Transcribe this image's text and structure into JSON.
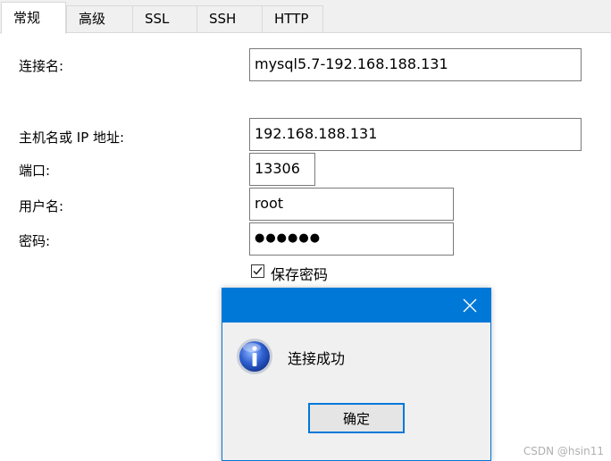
{
  "tabs": [
    {
      "label": "常规",
      "active": true
    },
    {
      "label": "高级",
      "active": false
    },
    {
      "label": "SSL",
      "active": false
    },
    {
      "label": "SSH",
      "active": false
    },
    {
      "label": "HTTP",
      "active": false
    }
  ],
  "form": {
    "connection_name_label": "连接名:",
    "connection_name_value": "mysql5.7-192.168.188.131",
    "host_label": "主机名或 IP 地址:",
    "host_value": "192.168.188.131",
    "port_label": "端口:",
    "port_value": "13306",
    "user_label": "用户名:",
    "user_value": "root",
    "password_label": "密码:",
    "password_value": "●●●●●●",
    "save_password_label": "保存密码",
    "save_password_checked": true
  },
  "dialog": {
    "message": "连接成功",
    "ok_label": "确定",
    "icon": "info-icon",
    "accent": "#0078d7"
  },
  "watermark": "CSDN @hsin11"
}
